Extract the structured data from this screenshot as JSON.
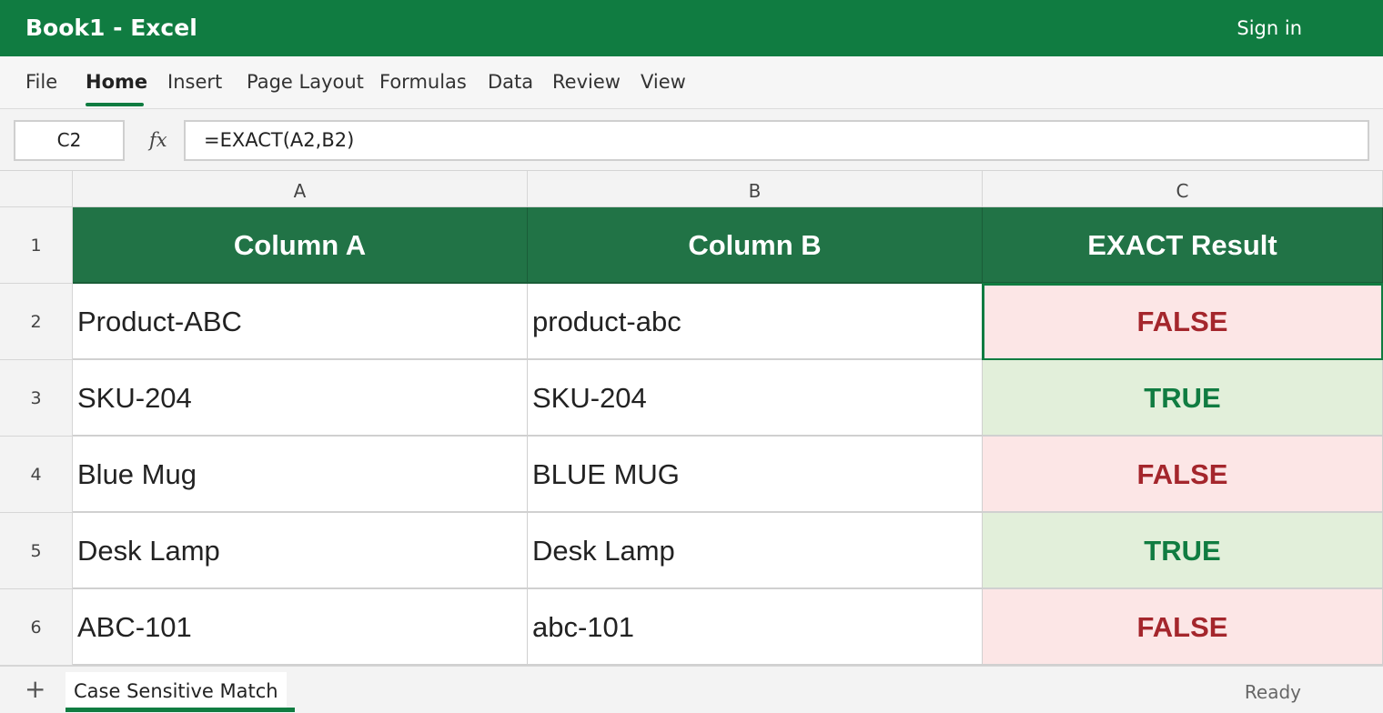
{
  "titlebar": {
    "title": "Book1 - Excel",
    "sign_in": "Sign in"
  },
  "ribbon": {
    "tabs": [
      {
        "label": "File"
      },
      {
        "label": "Home",
        "active": true
      },
      {
        "label": "Insert"
      },
      {
        "label": "Page Layout"
      },
      {
        "label": "Formulas"
      },
      {
        "label": "Data"
      },
      {
        "label": "Review"
      },
      {
        "label": "View"
      }
    ]
  },
  "formula_bar": {
    "name_box": "C2",
    "fx_label": "fx",
    "formula": "=EXACT(A2,B2)"
  },
  "grid": {
    "column_headers": [
      "A",
      "B",
      "C"
    ],
    "row_headers": [
      "1",
      "2",
      "3",
      "4",
      "5",
      "6"
    ],
    "header_row": [
      "Column A",
      "Column B",
      "EXACT Result"
    ],
    "rows": [
      {
        "a": "Product-ABC",
        "b": "product-abc",
        "c": "FALSE"
      },
      {
        "a": "SKU-204",
        "b": "SKU-204",
        "c": "TRUE"
      },
      {
        "a": "Blue Mug",
        "b": "BLUE MUG",
        "c": "FALSE"
      },
      {
        "a": "Desk Lamp",
        "b": "Desk Lamp",
        "c": "TRUE"
      },
      {
        "a": "ABC-101",
        "b": "abc-101",
        "c": "FALSE"
      }
    ],
    "selected_cell": "C2"
  },
  "statusbar": {
    "add_sheet_icon": "+",
    "sheet_tab": "Case Sensitive Match",
    "status": "Ready"
  },
  "colors": {
    "brand": "#107c41",
    "header_fill": "#217346",
    "true_fill": "#e2efda",
    "false_fill": "#fce6e6",
    "false_text": "#a4262c"
  }
}
